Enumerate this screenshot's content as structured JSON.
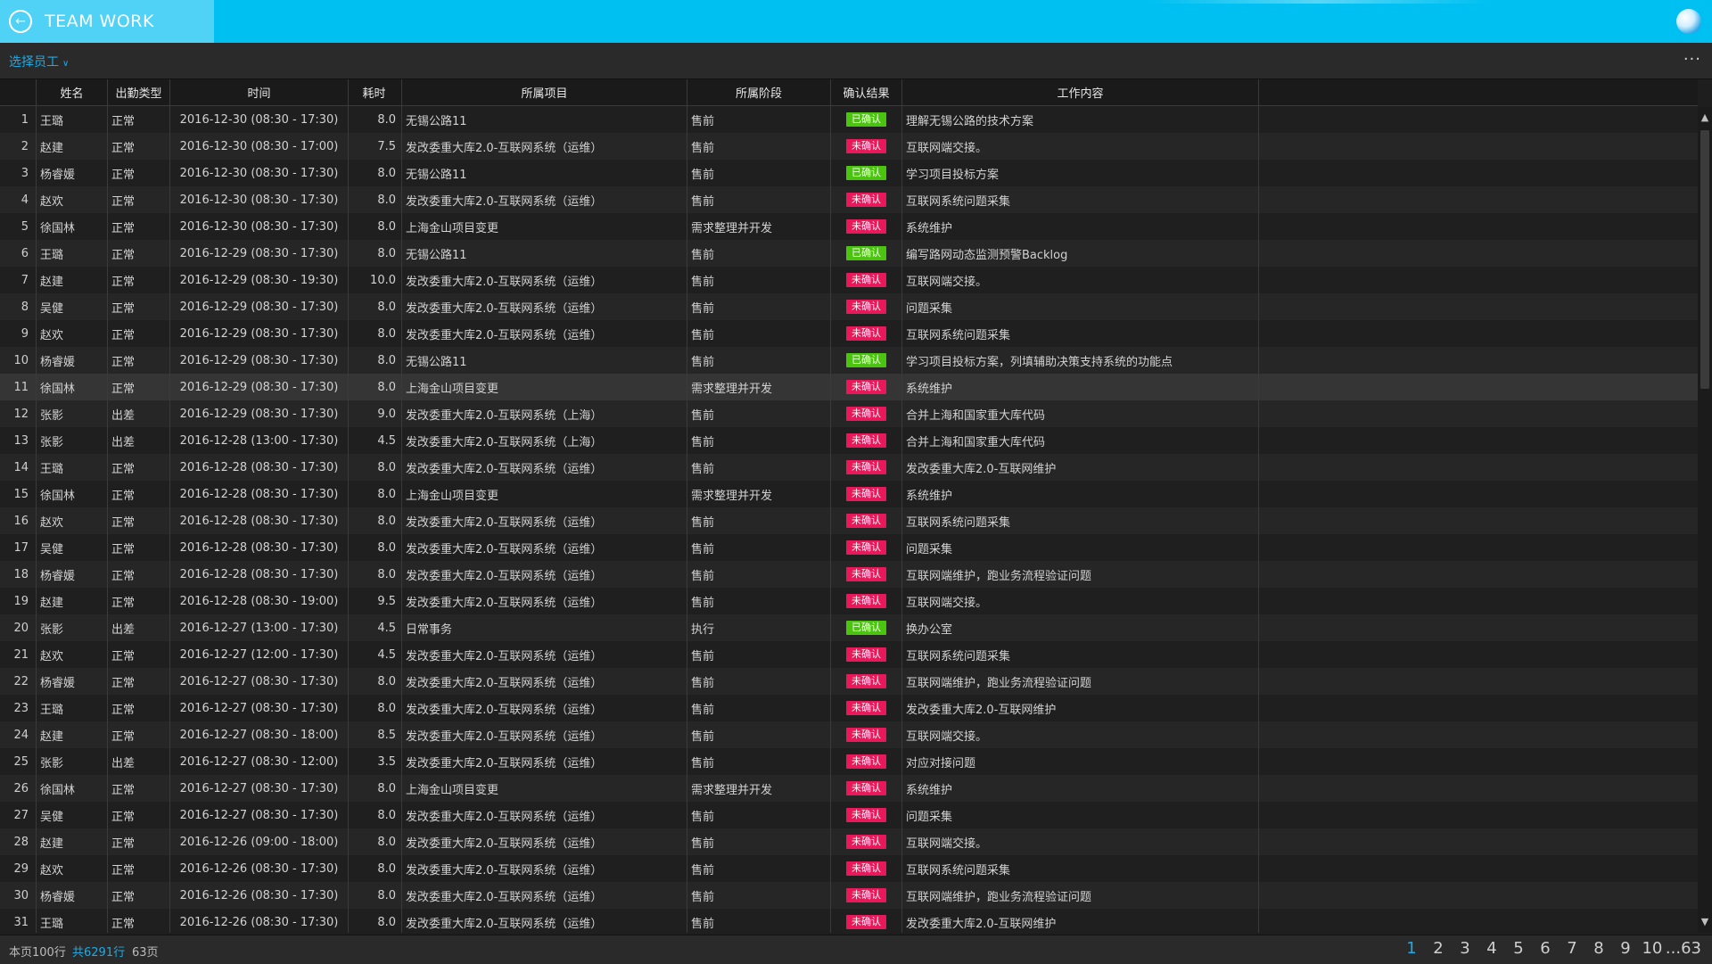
{
  "header": {
    "title": "TEAM WORK"
  },
  "toolbar": {
    "employee_select": "选择员工"
  },
  "table": {
    "columns": {
      "name": "姓名",
      "type": "出勤类型",
      "time": "时间",
      "hours": "耗时",
      "project": "所属项目",
      "stage": "所属阶段",
      "confirm": "确认结果",
      "work": "工作内容"
    },
    "rows": [
      [
        "1",
        "王璐",
        "正常",
        "2016-12-30 (08:30 - 17:30)",
        "8.0",
        "无锡公路11",
        "售前",
        "已确认",
        "理解无锡公路的技术方案"
      ],
      [
        "2",
        "赵建",
        "正常",
        "2016-12-30 (08:30 - 17:00)",
        "7.5",
        "发改委重大库2.0-互联网系统（运维）",
        "售前",
        "未确认",
        "互联网端交接。"
      ],
      [
        "3",
        "杨睿媛",
        "正常",
        "2016-12-30 (08:30 - 17:30)",
        "8.0",
        "无锡公路11",
        "售前",
        "已确认",
        "学习项目投标方案"
      ],
      [
        "4",
        "赵欢",
        "正常",
        "2016-12-30 (08:30 - 17:30)",
        "8.0",
        "发改委重大库2.0-互联网系统（运维）",
        "售前",
        "未确认",
        "互联网系统问题采集"
      ],
      [
        "5",
        "徐国林",
        "正常",
        "2016-12-30 (08:30 - 17:30)",
        "8.0",
        "上海金山项目变更",
        "需求整理并开发",
        "未确认",
        "系统维护"
      ],
      [
        "6",
        "王璐",
        "正常",
        "2016-12-29 (08:30 - 17:30)",
        "8.0",
        "无锡公路11",
        "售前",
        "已确认",
        "编写路网动态监测预警Backlog"
      ],
      [
        "7",
        "赵建",
        "正常",
        "2016-12-29 (08:30 - 19:30)",
        "10.0",
        "发改委重大库2.0-互联网系统（运维）",
        "售前",
        "未确认",
        "互联网端交接。"
      ],
      [
        "8",
        "吴健",
        "正常",
        "2016-12-29 (08:30 - 17:30)",
        "8.0",
        "发改委重大库2.0-互联网系统（运维）",
        "售前",
        "未确认",
        "问题采集"
      ],
      [
        "9",
        "赵欢",
        "正常",
        "2016-12-29 (08:30 - 17:30)",
        "8.0",
        "发改委重大库2.0-互联网系统（运维）",
        "售前",
        "未确认",
        "互联网系统问题采集"
      ],
      [
        "10",
        "杨睿媛",
        "正常",
        "2016-12-29 (08:30 - 17:30)",
        "8.0",
        "无锡公路11",
        "售前",
        "已确认",
        "学习项目投标方案，列填辅助决策支持系统的功能点"
      ],
      [
        "11",
        "徐国林",
        "正常",
        "2016-12-29 (08:30 - 17:30)",
        "8.0",
        "上海金山项目变更",
        "需求整理并开发",
        "未确认",
        "系统维护"
      ],
      [
        "12",
        "张影",
        "出差",
        "2016-12-29 (08:30 - 17:30)",
        "9.0",
        "发改委重大库2.0-互联网系统（上海）",
        "售前",
        "未确认",
        "合并上海和国家重大库代码"
      ],
      [
        "13",
        "张影",
        "出差",
        "2016-12-28 (13:00 - 17:30)",
        "4.5",
        "发改委重大库2.0-互联网系统（上海）",
        "售前",
        "未确认",
        "合并上海和国家重大库代码"
      ],
      [
        "14",
        "王璐",
        "正常",
        "2016-12-28 (08:30 - 17:30)",
        "8.0",
        "发改委重大库2.0-互联网系统（运维）",
        "售前",
        "未确认",
        "发改委重大库2.0-互联网维护"
      ],
      [
        "15",
        "徐国林",
        "正常",
        "2016-12-28 (08:30 - 17:30)",
        "8.0",
        "上海金山项目变更",
        "需求整理并开发",
        "未确认",
        "系统维护"
      ],
      [
        "16",
        "赵欢",
        "正常",
        "2016-12-28 (08:30 - 17:30)",
        "8.0",
        "发改委重大库2.0-互联网系统（运维）",
        "售前",
        "未确认",
        "互联网系统问题采集"
      ],
      [
        "17",
        "吴健",
        "正常",
        "2016-12-28 (08:30 - 17:30)",
        "8.0",
        "发改委重大库2.0-互联网系统（运维）",
        "售前",
        "未确认",
        "问题采集"
      ],
      [
        "18",
        "杨睿媛",
        "正常",
        "2016-12-28 (08:30 - 17:30)",
        "8.0",
        "发改委重大库2.0-互联网系统（运维）",
        "售前",
        "未确认",
        "互联网端维护，跑业务流程验证问题"
      ],
      [
        "19",
        "赵建",
        "正常",
        "2016-12-28 (08:30 - 19:00)",
        "9.5",
        "发改委重大库2.0-互联网系统（运维）",
        "售前",
        "未确认",
        "互联网端交接。"
      ],
      [
        "20",
        "张影",
        "出差",
        "2016-12-27 (13:00 - 17:30)",
        "4.5",
        "日常事务",
        "执行",
        "已确认",
        "换办公室"
      ],
      [
        "21",
        "赵欢",
        "正常",
        "2016-12-27 (12:00 - 17:30)",
        "4.5",
        "发改委重大库2.0-互联网系统（运维）",
        "售前",
        "未确认",
        "互联网系统问题采集"
      ],
      [
        "22",
        "杨睿媛",
        "正常",
        "2016-12-27 (08:30 - 17:30)",
        "8.0",
        "发改委重大库2.0-互联网系统（运维）",
        "售前",
        "未确认",
        "互联网端维护，跑业务流程验证问题"
      ],
      [
        "23",
        "王璐",
        "正常",
        "2016-12-27 (08:30 - 17:30)",
        "8.0",
        "发改委重大库2.0-互联网系统（运维）",
        "售前",
        "未确认",
        "发改委重大库2.0-互联网维护"
      ],
      [
        "24",
        "赵建",
        "正常",
        "2016-12-27 (08:30 - 18:00)",
        "8.5",
        "发改委重大库2.0-互联网系统（运维）",
        "售前",
        "未确认",
        "互联网端交接。"
      ],
      [
        "25",
        "张影",
        "出差",
        "2016-12-27 (08:30 - 12:00)",
        "3.5",
        "发改委重大库2.0-互联网系统（运维）",
        "售前",
        "未确认",
        "对应对接问题"
      ],
      [
        "26",
        "徐国林",
        "正常",
        "2016-12-27 (08:30 - 17:30)",
        "8.0",
        "上海金山项目变更",
        "需求整理并开发",
        "未确认",
        "系统维护"
      ],
      [
        "27",
        "吴健",
        "正常",
        "2016-12-27 (08:30 - 17:30)",
        "8.0",
        "发改委重大库2.0-互联网系统（运维）",
        "售前",
        "未确认",
        "问题采集"
      ],
      [
        "28",
        "赵建",
        "正常",
        "2016-12-26 (09:00 - 18:00)",
        "8.0",
        "发改委重大库2.0-互联网系统（运维）",
        "售前",
        "未确认",
        "互联网端交接。"
      ],
      [
        "29",
        "赵欢",
        "正常",
        "2016-12-26 (08:30 - 17:30)",
        "8.0",
        "发改委重大库2.0-互联网系统（运维）",
        "售前",
        "未确认",
        "互联网系统问题采集"
      ],
      [
        "30",
        "杨睿媛",
        "正常",
        "2016-12-26 (08:30 - 17:30)",
        "8.0",
        "发改委重大库2.0-互联网系统（运维）",
        "售前",
        "未确认",
        "互联网端维护，跑业务流程验证问题"
      ],
      [
        "31",
        "王璐",
        "正常",
        "2016-12-26 (08:30 - 17:30)",
        "8.0",
        "发改委重大库2.0-互联网系统（运维）",
        "售前",
        "未确认",
        "发改委重大库2.0-互联网维护"
      ]
    ],
    "selected_row": 11,
    "confirmed_label": "已确认"
  },
  "footer": {
    "page_rows": "本页100行",
    "total": "共6291行",
    "pages": "63页",
    "pager": [
      "1",
      "2",
      "3",
      "4",
      "5",
      "6",
      "7",
      "8",
      "9",
      "10",
      "...63"
    ],
    "current_page": "1"
  },
  "colors": {
    "header_bg": "#00c0f2",
    "accent": "#21a9e3",
    "confirmed": "#4bc40f",
    "unconfirmed": "#e8185a"
  },
  "icons": {
    "back": "back-circle-icon",
    "logo": "globe-logo-icon",
    "more": "more-dots-icon",
    "dropdown": "chevron-down-icon"
  }
}
